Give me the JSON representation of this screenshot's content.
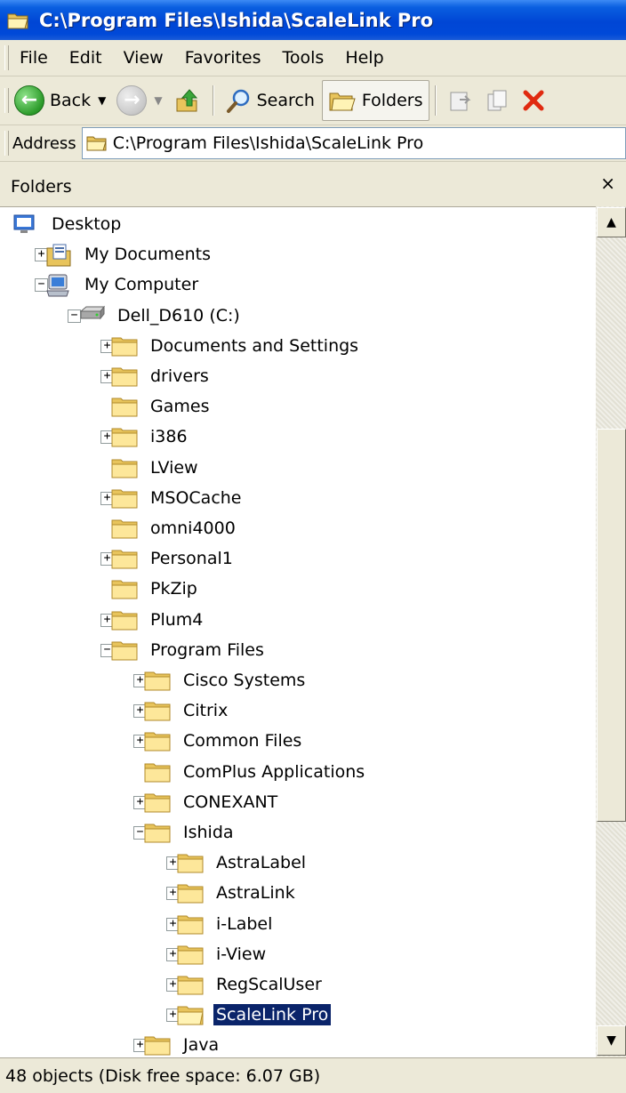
{
  "window": {
    "title": "C:\\Program Files\\Ishida\\ScaleLink Pro",
    "icon": "folder-open-icon"
  },
  "menu": [
    "File",
    "Edit",
    "View",
    "Favorites",
    "Tools",
    "Help"
  ],
  "toolbar": {
    "back_label": "Back",
    "search_label": "Search",
    "folders_label": "Folders"
  },
  "address": {
    "label": "Address",
    "value": "C:\\Program Files\\Ishida\\ScaleLink Pro"
  },
  "pane": {
    "title": "Folders",
    "close_glyph": "×"
  },
  "tree": [
    {
      "label": "Desktop",
      "icon": "desktop-icon",
      "depth": 0,
      "expander": "none"
    },
    {
      "label": "My Documents",
      "icon": "my-documents-icon",
      "depth": 1,
      "expander": "+"
    },
    {
      "label": "My Computer",
      "icon": "my-computer-icon",
      "depth": 1,
      "expander": "−"
    },
    {
      "label": "Dell_D610 (C:)",
      "icon": "drive-icon",
      "depth": 2,
      "expander": "−"
    },
    {
      "label": "Documents and Settings",
      "icon": "folder-icon",
      "depth": 3,
      "expander": "+"
    },
    {
      "label": "drivers",
      "icon": "folder-icon",
      "depth": 3,
      "expander": "+"
    },
    {
      "label": "Games",
      "icon": "folder-icon",
      "depth": 3,
      "expander": "none"
    },
    {
      "label": "i386",
      "icon": "folder-icon",
      "depth": 3,
      "expander": "+"
    },
    {
      "label": "LView",
      "icon": "folder-icon",
      "depth": 3,
      "expander": "none"
    },
    {
      "label": "MSOCache",
      "icon": "folder-icon",
      "depth": 3,
      "expander": "+"
    },
    {
      "label": "omni4000",
      "icon": "folder-icon",
      "depth": 3,
      "expander": "none"
    },
    {
      "label": "Personal1",
      "icon": "folder-icon",
      "depth": 3,
      "expander": "+"
    },
    {
      "label": "PkZip",
      "icon": "folder-icon",
      "depth": 3,
      "expander": "none"
    },
    {
      "label": "Plum4",
      "icon": "folder-icon",
      "depth": 3,
      "expander": "+"
    },
    {
      "label": "Program Files",
      "icon": "folder-icon",
      "depth": 3,
      "expander": "−"
    },
    {
      "label": "Cisco Systems",
      "icon": "folder-icon",
      "depth": 4,
      "expander": "+"
    },
    {
      "label": "Citrix",
      "icon": "folder-icon",
      "depth": 4,
      "expander": "+"
    },
    {
      "label": "Common Files",
      "icon": "folder-icon",
      "depth": 4,
      "expander": "+"
    },
    {
      "label": "ComPlus Applications",
      "icon": "folder-icon",
      "depth": 4,
      "expander": "none"
    },
    {
      "label": "CONEXANT",
      "icon": "folder-icon",
      "depth": 4,
      "expander": "+"
    },
    {
      "label": "Ishida",
      "icon": "folder-icon",
      "depth": 4,
      "expander": "−"
    },
    {
      "label": "AstraLabel",
      "icon": "folder-icon",
      "depth": 5,
      "expander": "+"
    },
    {
      "label": "AstraLink",
      "icon": "folder-icon",
      "depth": 5,
      "expander": "+"
    },
    {
      "label": "i-Label",
      "icon": "folder-icon",
      "depth": 5,
      "expander": "+"
    },
    {
      "label": "i-View",
      "icon": "folder-icon",
      "depth": 5,
      "expander": "+"
    },
    {
      "label": "RegScalUser",
      "icon": "folder-icon",
      "depth": 5,
      "expander": "+"
    },
    {
      "label": "ScaleLink Pro",
      "icon": "folder-open-icon",
      "depth": 5,
      "expander": "+",
      "selected": true
    },
    {
      "label": "Java",
      "icon": "folder-icon",
      "depth": 4,
      "expander": "+"
    }
  ],
  "status": {
    "text": "48 objects (Disk free space: 6.07 GB)"
  },
  "colors": {
    "titlebar": "#0046d5",
    "selection": "#0a246a",
    "chrome": "#ece9d8"
  }
}
